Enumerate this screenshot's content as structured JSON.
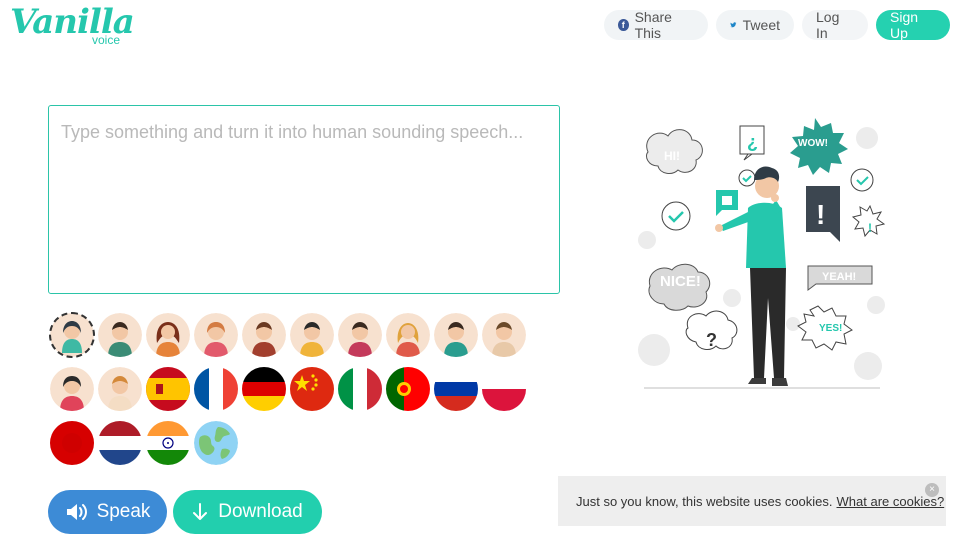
{
  "header": {
    "logo_word": "Vanilla",
    "logo_sub": "voice",
    "share_label": "Share This",
    "tweet_label": "Tweet",
    "login_label": "Log In",
    "signup_label": "Sign Up"
  },
  "editor": {
    "placeholder": "Type something and turn it into human sounding speech...",
    "value": ""
  },
  "voices": [
    {
      "name": "avatar-female-1",
      "selected": true
    },
    {
      "name": "avatar-male-1"
    },
    {
      "name": "avatar-female-2"
    },
    {
      "name": "avatar-female-3"
    },
    {
      "name": "avatar-male-2"
    },
    {
      "name": "avatar-male-3"
    },
    {
      "name": "avatar-male-4"
    },
    {
      "name": "avatar-female-4"
    },
    {
      "name": "avatar-male-5"
    },
    {
      "name": "avatar-male-6"
    },
    {
      "name": "avatar-female-5"
    },
    {
      "name": "avatar-male-7"
    },
    {
      "name": "flag-spain"
    },
    {
      "name": "flag-france"
    },
    {
      "name": "flag-germany"
    },
    {
      "name": "flag-china"
    },
    {
      "name": "flag-italy"
    },
    {
      "name": "flag-portugal"
    },
    {
      "name": "flag-russia"
    },
    {
      "name": "flag-poland"
    },
    {
      "name": "flag-japan"
    },
    {
      "name": "flag-netherlands"
    },
    {
      "name": "flag-india"
    },
    {
      "name": "globe"
    }
  ],
  "actions": {
    "speak_label": "Speak",
    "download_label": "Download"
  },
  "illustration": {
    "bubble_hi": "HI!",
    "bubble_wow": "WOW!",
    "bubble_nice": "NICE!",
    "bubble_yeah": "YEAH!",
    "bubble_yes": "YES!",
    "bubble_q": "?",
    "bubble_iq": "¿",
    "bubble_ex": "!"
  },
  "cookie": {
    "text": "Just so you know, this website uses cookies.",
    "link": "What are cookies?",
    "close": "×"
  },
  "colors": {
    "brand": "#25c7ad",
    "speak": "#3d8bd6",
    "download": "#22cfae"
  }
}
